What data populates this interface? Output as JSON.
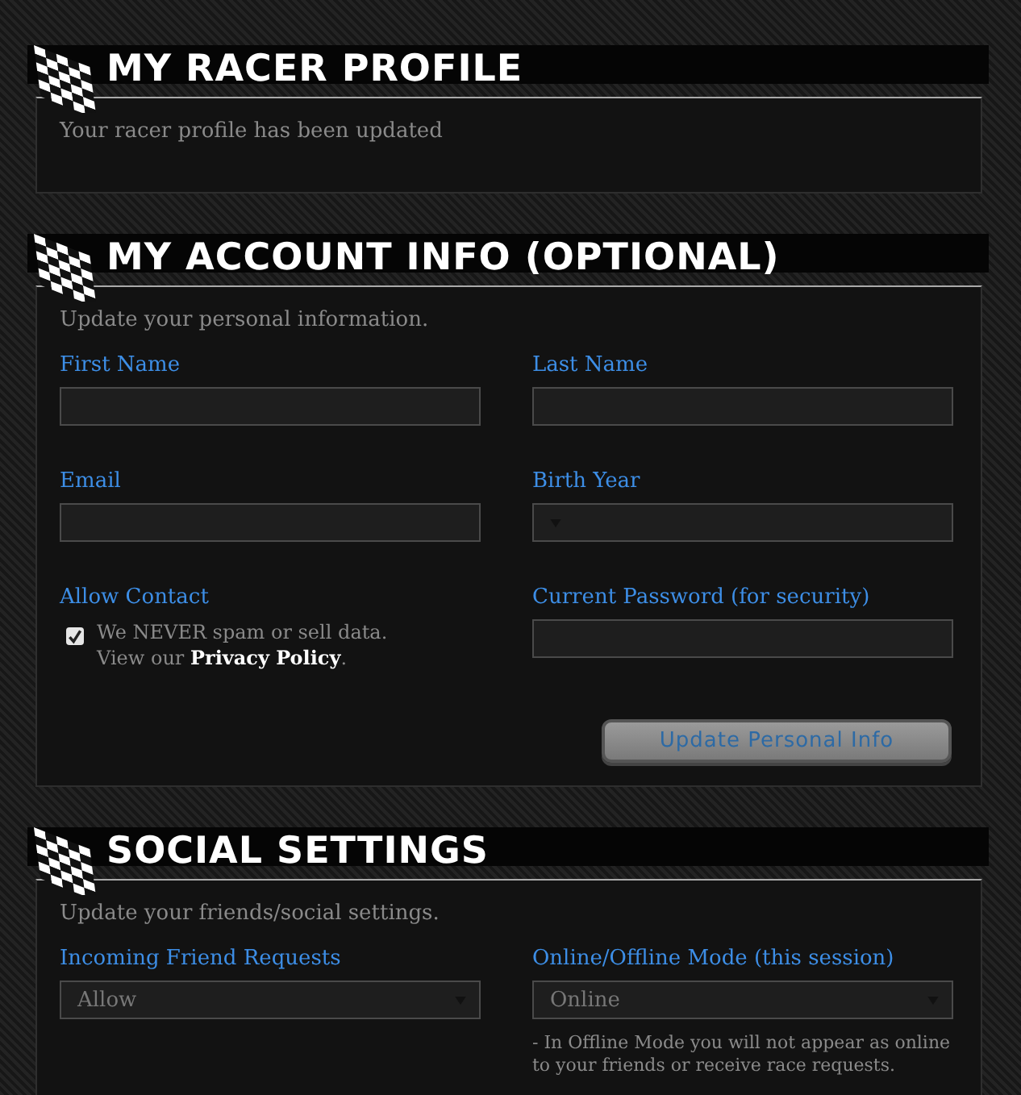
{
  "sections": [
    {
      "kind": "message",
      "title": "MY RACER PROFILE",
      "message": "Your racer profile has been updated"
    },
    {
      "kind": "form",
      "title": "MY ACCOUNT INFO (OPTIONAL)",
      "intro": "Update your personal information.",
      "fields": [
        {
          "kind": "text",
          "label": "First Name"
        },
        {
          "kind": "text",
          "label": "Last Name"
        },
        {
          "kind": "text",
          "label": "Email"
        },
        {
          "kind": "select",
          "label": "Birth Year"
        },
        {
          "kind": "checkbox",
          "label": "Allow Contact",
          "checked": true,
          "note": "We NEVER spam or sell data.",
          "link_lead": "View our ",
          "link": "Privacy Policy",
          "link_tail": "."
        },
        {
          "kind": "password",
          "label": "Current Password (for security)"
        }
      ],
      "button": "Update Personal Info"
    },
    {
      "kind": "form",
      "title": "SOCIAL SETTINGS",
      "intro": "Update your friends/social settings.",
      "fields": [
        {
          "kind": "select",
          "label": "Incoming Friend Requests",
          "value": "Allow"
        },
        {
          "kind": "select",
          "label": "Online/Offline Mode (this session)",
          "value": "Online",
          "note": "- In Offline Mode you will not appear as online to your friends or receive race requests."
        }
      ]
    }
  ]
}
